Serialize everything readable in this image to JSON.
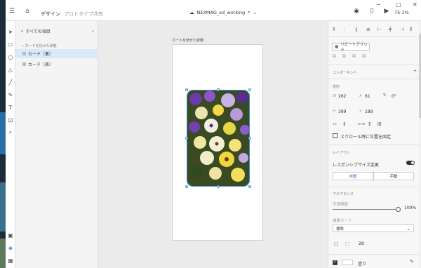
{
  "header": {
    "tabs": [
      "デザイン",
      "プロトタイプ",
      "共有"
    ],
    "doc_title": "NEXMAG_xd_working",
    "doc_suffix": "*",
    "zoom": "75.1%"
  },
  "layers": {
    "search_label": "すべての項目",
    "back_label": "カードを伏せた状態",
    "items": [
      "カード（裏）",
      "カード（表）"
    ]
  },
  "canvas": {
    "artboard_label": "カードを伏せた状態"
  },
  "props": {
    "repeat_grid": "リピートグリッド",
    "components": "コンポーネント",
    "transform": "変形",
    "w_label": "W",
    "w_value": "262",
    "x_label": "X",
    "x_value": "61",
    "rot_value": "0°",
    "h_label": "H",
    "h_value": "399",
    "y_label": "Y",
    "y_value": "189",
    "fix_scroll": "スクロール時に位置を固定",
    "layout": "レイアウト",
    "responsive": "レスポンシブサイズ変更",
    "auto": "自動",
    "manual": "手動",
    "appearance": "アピアランス",
    "opacity_label": "不透明度",
    "opacity_value": "100%",
    "blend_label": "描画モード",
    "blend_value": "標準",
    "radius_value": "28",
    "fill_label": "塗り"
  },
  "colors": {
    "accent": "#3d86d6",
    "selected_row": "#d9e9f8"
  }
}
